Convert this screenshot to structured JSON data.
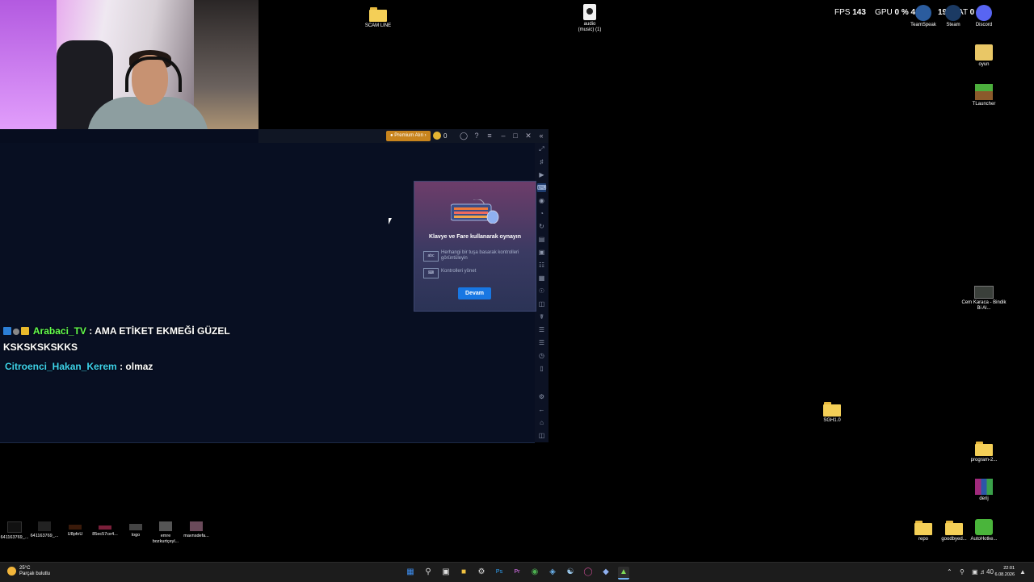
{
  "desktop": {
    "icons": {
      "scam_line": "SCAM LINE",
      "audio": "audio\n(music) (1)",
      "teamspeak": "TeamSpeak",
      "steam": "Steam",
      "discord": "Discord",
      "oyun": "oyun",
      "tlauncher": "TLauncher",
      "cem_karaca": "Cem Karaca - Bindik Bi Al...",
      "sgh": "SGH1.0",
      "program": "program-2...",
      "derij": "derij",
      "repo": "repo",
      "goodbye": "goodbyed...",
      "autohotkey": "AutoHotke..."
    },
    "bottom_thumbs": [
      "641163769_...",
      "641163769_...",
      "U8pfoU",
      "85ec57ce4...",
      "logo",
      "emre bozkurtçeyl...",
      "mavnsdefa..."
    ]
  },
  "overlay": {
    "fps_label": "FPS",
    "fps_value": "143",
    "gpu_label": "GPU",
    "gpu_value": "0 %",
    "gpu_temp": "42 °C",
    "cpu_value": "19",
    "lat_label": "LAT",
    "lat_value": "0 ms"
  },
  "emulator": {
    "premium_label": "Premium Alın",
    "coin_count": "0",
    "dialog": {
      "title": "Klavye ve Fare kullanarak oynayın",
      "option1_icon": "abc",
      "option1_text": "Herhangi bir tuşa basarak kontrolleri görüntüleyin",
      "option2_text": "Kontrolleri yönet",
      "continue_button": "Devam"
    }
  },
  "chat": {
    "messages": [
      {
        "user": "Arabaci_TV",
        "text": ": AMA ETİKET EKMEĞİ GÜZEL KSKSKSKSKKS"
      },
      {
        "user": "Citroenci_Hakan_Kerem",
        "text": ": olmaz"
      }
    ]
  },
  "taskbar": {
    "weather_temp": "25°C",
    "weather_desc": "Parçalı bulutlu",
    "time": "22:01",
    "date": "6.08.2026",
    "volume": "40"
  },
  "colors": {
    "premium": "#c8841d",
    "devam_button": "#1877e3",
    "chat_user1": "#64ff4d",
    "chat_user2": "#3ed3ec"
  }
}
